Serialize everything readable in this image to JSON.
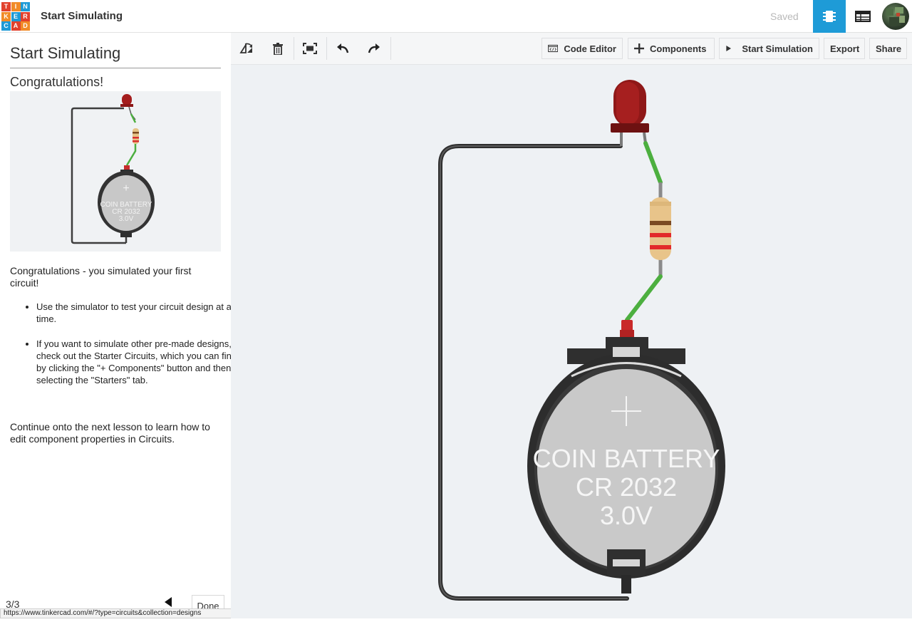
{
  "header": {
    "logo_letters": [
      "T",
      "I",
      "N",
      "K",
      "E",
      "R",
      "C",
      "A",
      "D"
    ],
    "logo_colors": [
      "#e2412c",
      "#f18b28",
      "#1d9ad6",
      "#f18b28",
      "#1d9ad6",
      "#e2412c",
      "#1d9ad6",
      "#e2412c",
      "#f18b28"
    ],
    "title": "Start Simulating",
    "saved_label": "Saved",
    "view_buttons": [
      {
        "icon": "circuit-view-icon",
        "active": true
      },
      {
        "icon": "component-list-icon",
        "active": false
      }
    ],
    "avatar_icon": "user-avatar",
    "accent_color": "#1e9bd7"
  },
  "lesson": {
    "title": "Start Simulating",
    "subtitle": "Congratulations!",
    "intro": "Congratulations - you simulated your first circuit!",
    "bullets": [
      "Use the simulator to test your circuit design at any time.",
      "If you want to simulate other pre-made designs, check out the Starter Circuits, which you can find by clicking the \"+ Components\" button and then selecting the \"Starters\" tab."
    ],
    "outro": "Continue onto the next lesson to learn how to edit component properties in Circuits.",
    "step": "3/3",
    "done_label": "Done"
  },
  "toolbar": {
    "tools": [
      "rotate-icon",
      "delete-icon",
      "fit-view-icon",
      "undo-icon",
      "redo-icon"
    ],
    "code_editor_label": "Code Editor",
    "components_label": "Components",
    "start_simulation_label": "Start Simulation",
    "export_label": "Export",
    "share_label": "Share"
  },
  "circuit": {
    "battery_label_line1": "COIN BATTERY",
    "battery_label_line2": "CR 2032",
    "battery_label_line3": "3.0V",
    "battery_plus": "+",
    "led_color": "#a41d1d",
    "wire_color": "#4caf3f",
    "return_wire_color": "#3c3c3c"
  },
  "status_bar": {
    "url": "https://www.tinkercad.com/#/?type=circuits&collection=designs"
  }
}
